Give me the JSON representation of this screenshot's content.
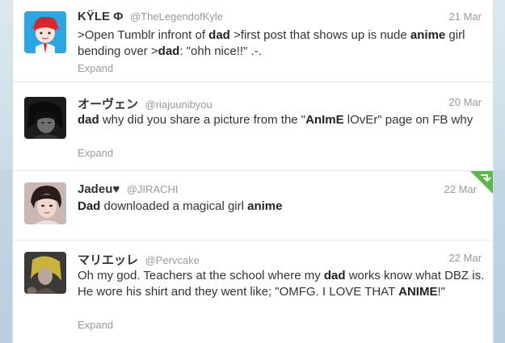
{
  "tweets": [
    {
      "name": "KŸLE Φ",
      "handle": "@TheLegendofKyle",
      "time": "21 Mar",
      "text": [
        {
          "t": ">Open Tumblr infront of ",
          "b": false
        },
        {
          "t": "dad",
          "b": true
        },
        {
          "t": " >first post that shows up is nude ",
          "b": false
        },
        {
          "t": "anime",
          "b": true
        },
        {
          "t": " girl bending over >",
          "b": false
        },
        {
          "t": "dad",
          "b": true
        },
        {
          "t": ": \"ohh nice!!\" .-.",
          "b": false
        }
      ],
      "expand": "Expand"
    },
    {
      "name": "オーヴェン",
      "handle": "@riajuunibyou",
      "time": "20 Mar",
      "text": [
        {
          "t": "dad",
          "b": true
        },
        {
          "t": " why did you share a picture from the \"",
          "b": false
        },
        {
          "t": "AnImE",
          "b": true
        },
        {
          "t": " lOvEr\" page on FB why",
          "b": false
        }
      ],
      "expand": "Expand"
    },
    {
      "name": "Jadeu♥",
      "handle": "@JIRACHI",
      "time": "22 Mar",
      "text": [
        {
          "t": "Dad",
          "b": true
        },
        {
          "t": " downloaded a magical girl ",
          "b": false
        },
        {
          "t": "anime",
          "b": true
        }
      ],
      "expand": "",
      "retweet_flag_color": "#5db84a"
    },
    {
      "name": "マリエッレ",
      "handle": "@Pervcake",
      "time": "22 Mar",
      "text": [
        {
          "t": "Oh my god. Teachers at the school where my ",
          "b": false
        },
        {
          "t": "dad",
          "b": true
        },
        {
          "t": " works know what DBZ is. He wore his shirt and they went like; \"OMFG. I LOVE THAT ",
          "b": false
        },
        {
          "t": "ANIME",
          "b": true
        },
        {
          "t": "!\"",
          "b": false
        }
      ],
      "expand": "Expand"
    }
  ],
  "colors": {
    "text": "#333333",
    "muted": "#999999",
    "background": "#c8dbe6"
  }
}
